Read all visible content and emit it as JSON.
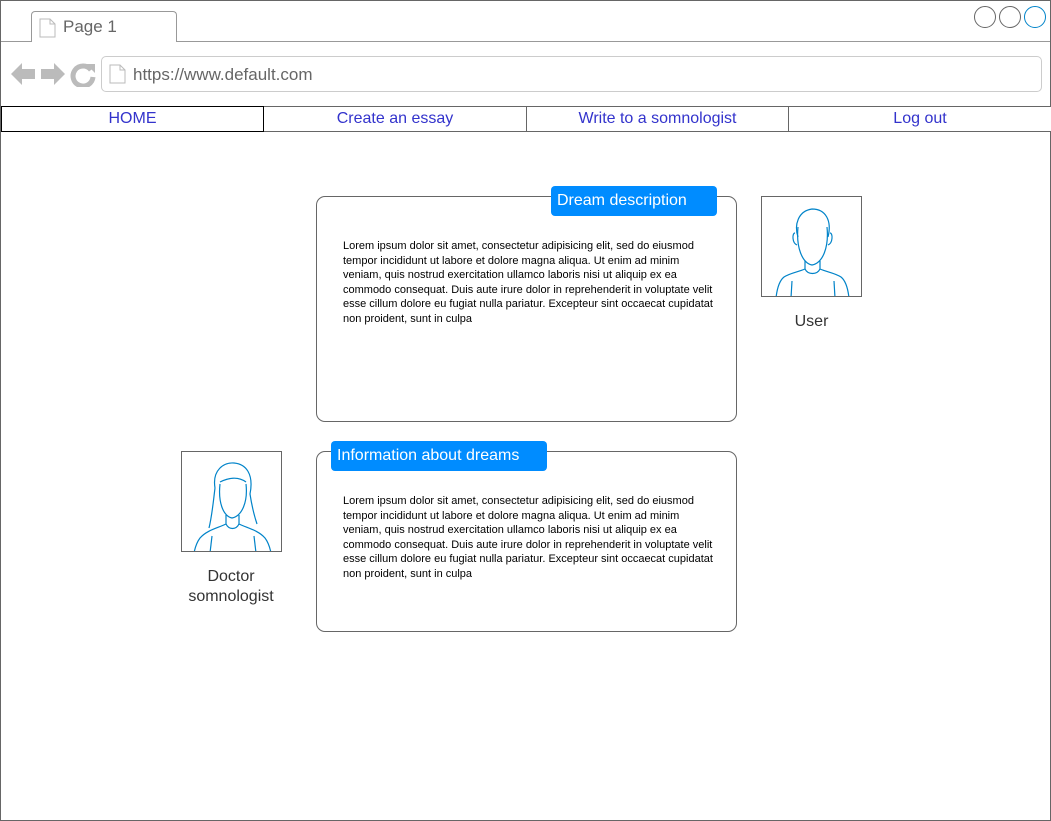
{
  "browser": {
    "tab_title": "Page 1",
    "url": "https://www.default.com"
  },
  "menu": {
    "items": [
      "HOME",
      "Create an essay",
      "Write to a somnologist",
      "Log out"
    ]
  },
  "dream_card": {
    "label": "Dream description",
    "text": "Lorem ipsum dolor sit amet, consectetur adipisicing elit, sed do eiusmod tempor incididunt ut labore et dolore magna aliqua. Ut enim ad minim veniam, quis nostrud exercitation ullamco laboris nisi ut aliquip ex ea commodo consequat. Duis aute irure dolor in reprehenderit in voluptate velit esse cillum dolore eu fugiat nulla pariatur. Excepteur sint occaecat cupidatat non proident, sunt in culpa"
  },
  "info_card": {
    "label": "Information about dreams",
    "text": "Lorem ipsum dolor sit amet, consectetur adipisicing elit, sed do eiusmod tempor incididunt ut labore et dolore magna aliqua. Ut enim ad minim veniam, quis nostrud exercitation ullamco laboris nisi ut aliquip ex ea commodo consequat. Duis aute irure dolor in reprehenderit in voluptate velit esse cillum dolore eu fugiat nulla pariatur. Excepteur sint occaecat cupidatat non proident, sunt in culpa"
  },
  "user": {
    "caption": "User"
  },
  "doctor": {
    "caption": "Doctor somnologist"
  },
  "colors": {
    "accent": "#008cff",
    "menu_text": "#3333cc",
    "avatar_stroke": "#0083c9"
  },
  "icons": {
    "tab": "page-icon",
    "back": "back-arrow-icon",
    "forward": "forward-arrow-icon",
    "reload": "reload-icon",
    "address": "page-icon"
  }
}
